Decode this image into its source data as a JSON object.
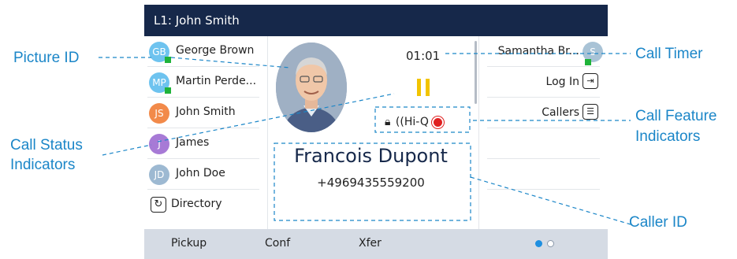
{
  "titlebar": {
    "line_label": "L1: John Smith"
  },
  "contacts": [
    {
      "initials": "GB",
      "name": "George Brown",
      "color": "#6ec3ef",
      "presence": true
    },
    {
      "initials": "MP",
      "name": "Martin Perde...",
      "color": "#6ec3ef",
      "presence": true
    },
    {
      "initials": "JS",
      "name": "John Smith",
      "color": "#f28a4a",
      "presence": false
    },
    {
      "initials": "J",
      "name": "James",
      "color": "#a77ad6",
      "presence": false
    },
    {
      "initials": "JD",
      "name": "John Doe",
      "color": "#9db9d2",
      "presence": false
    }
  ],
  "directory": {
    "label": "Directory",
    "icon": "refresh-icon"
  },
  "call": {
    "timer": "01:01",
    "status_icon": "hold-icon",
    "features": {
      "lock_icon": "lock-icon",
      "hiq": "Hi-Q",
      "record_icon": "record-icon"
    },
    "caller_name": "Francois Dupont",
    "caller_number": "+4969435559200"
  },
  "right_keys": [
    {
      "label": "Samantha Br...",
      "initials": "S",
      "icon": "avatar"
    },
    {
      "label": "Log In",
      "icon": "login-icon"
    },
    {
      "label": "Callers",
      "icon": "callers-list-icon"
    }
  ],
  "softkeys": [
    "Pickup",
    "Conf",
    "Xfer"
  ],
  "page_indicator": {
    "pages": 2,
    "current": 1
  },
  "callouts": {
    "picture_id": "Picture ID",
    "call_status_1": "Call Status",
    "call_status_2": "Indicators",
    "call_timer": "Call Timer",
    "call_feature_1": "Call Feature",
    "call_feature_2": "Indicators",
    "caller_id": "Caller ID"
  },
  "colors": {
    "titlebar": "#16284a",
    "softkey_bar": "#d5dbe4",
    "callout": "#1b86c8",
    "hold": "#f2c400",
    "presence": "#1fb33a",
    "record": "#e02020"
  }
}
